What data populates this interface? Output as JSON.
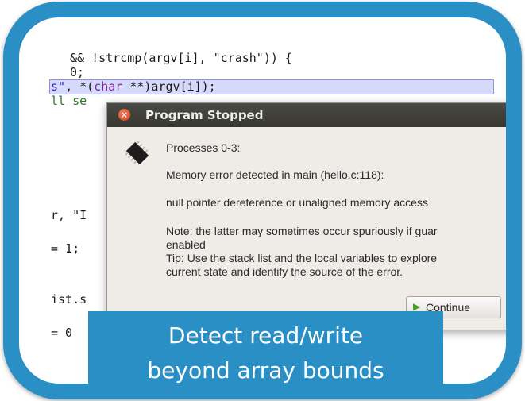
{
  "code": {
    "line1": "&& !strcmp(argv[i], \"crash\")) {",
    "line2": "0;",
    "line3_str": "s\"",
    "line3_mid": ", *(",
    "line3_kw": "char",
    "line3_end": " **)argv[i]);",
    "line4": "ll se",
    "line5": "r, \"I",
    "line6": "= 1;",
    "line7": "ist.s",
    "line8": "= 0"
  },
  "dialog": {
    "title": "Program Stopped",
    "line_processes": "Processes 0-3:",
    "line_memory": "Memory error detected in main (hello.c:118):",
    "line_null": "null pointer dereference or unaligned memory access",
    "line_note1": "Note: the latter may sometimes occur spuriously if guar",
    "line_note2": "enabled",
    "line_tip1": "Tip: Use the stack list and the local variables to explore",
    "line_tip2": "current state and identify the source of the error.",
    "continue_label": "Continue"
  },
  "banner": {
    "line1": "Detect read/write",
    "line2": "beyond array bounds"
  },
  "colors": {
    "frame": "#2a8fc5",
    "highlight": "#d7d9fb"
  }
}
